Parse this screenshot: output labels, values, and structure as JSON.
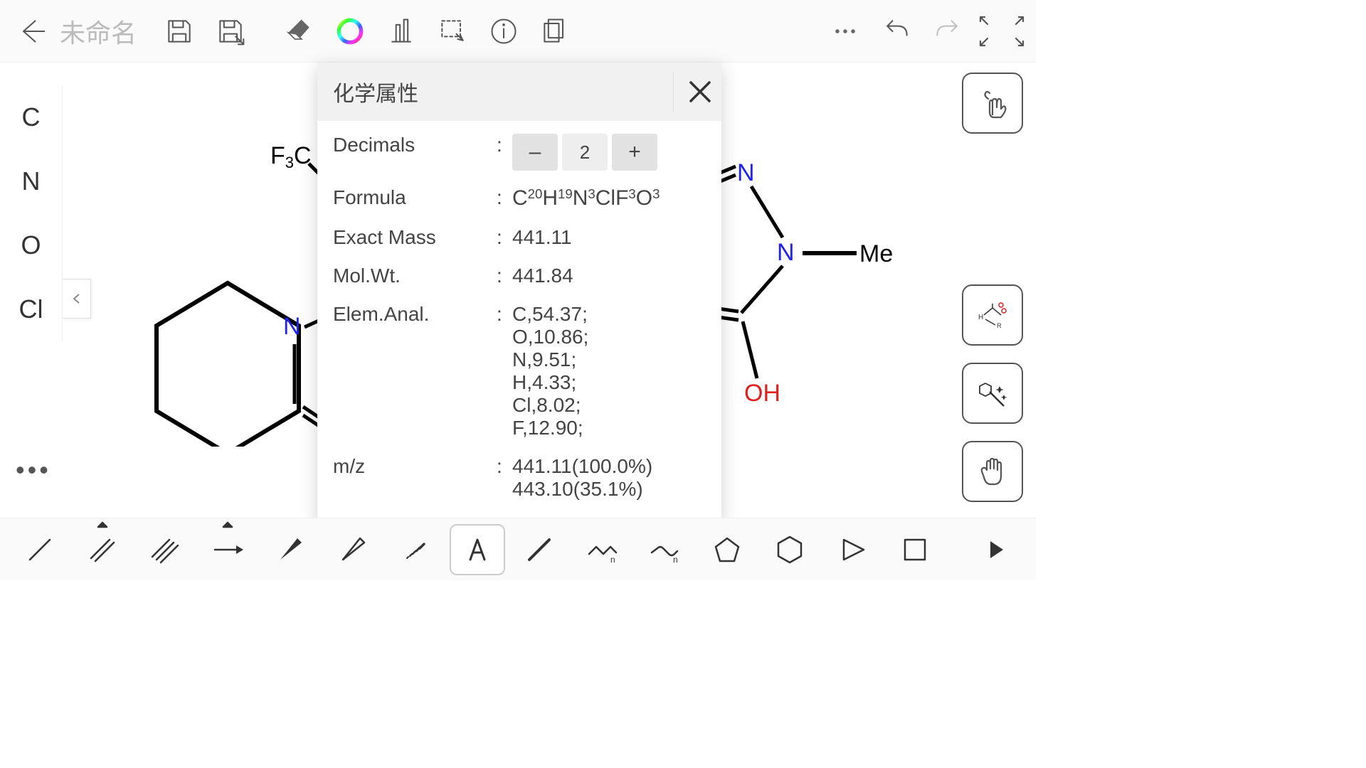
{
  "header": {
    "title": "未命名"
  },
  "left_atoms": [
    "C",
    "N",
    "O",
    "Cl"
  ],
  "modal": {
    "title": "化学属性",
    "decimals_label": "Decimals",
    "decimals_value": "2",
    "rows": {
      "formula_label": "Formula",
      "formula_html_parts": {
        "C": "20",
        "H": "19",
        "N": "3",
        "Cl": "",
        "F": "3",
        "O": "3"
      },
      "exact_mass_label": "Exact Mass",
      "exact_mass_value": "441.11",
      "mol_wt_label": "Mol.Wt.",
      "mol_wt_value": "441.84",
      "elem_anal_label": "Elem.Anal.",
      "elem_anal_lines": [
        "C,54.37;",
        "O,10.86;",
        "N,9.51;",
        "H,4.33;",
        "Cl,8.02;",
        "F,12.90;"
      ],
      "mz_label": "m/z",
      "mz_lines": [
        "441.11(100.0%)",
        "443.10(35.1%)"
      ]
    }
  },
  "chem": {
    "left_group": "F₃C",
    "n1": "N",
    "n2": "N",
    "n3": "N",
    "me": "Me",
    "oh": "OH"
  },
  "bottom_tool_selected": "text"
}
